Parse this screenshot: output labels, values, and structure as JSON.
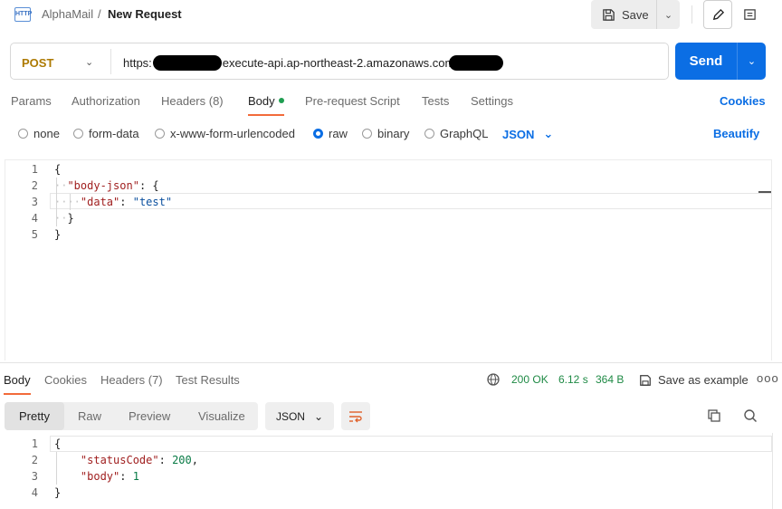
{
  "header": {
    "app_icon_text": "HTTP",
    "breadcrumb_parent": "AlphaMail",
    "breadcrumb_sep": "/",
    "title": "New Request",
    "save_label": "Save"
  },
  "request": {
    "method": "POST",
    "url_prefix": "https:",
    "url_middle": "execute-api.ap-northeast-2.amazonaws.com",
    "send_label": "Send"
  },
  "request_tabs": {
    "params": "Params",
    "authorization": "Authorization",
    "headers": "Headers (8)",
    "body": "Body",
    "pre_request": "Pre-request Script",
    "tests": "Tests",
    "settings": "Settings",
    "cookies": "Cookies"
  },
  "body_types": {
    "none": "none",
    "form_data": "form-data",
    "urlencoded": "x-www-form-urlencoded",
    "raw": "raw",
    "binary": "binary",
    "graphql": "GraphQL",
    "selected_format": "JSON",
    "beautify": "Beautify"
  },
  "request_body": {
    "line_numbers": [
      "1",
      "2",
      "3",
      "4",
      "5"
    ],
    "l1": "{",
    "l2_key": "\"body-json\"",
    "l2_rest": ": {",
    "l3_key": "\"data\"",
    "l3_sep": ": ",
    "l3_val": "\"test\"",
    "l4": "}",
    "l5": "}"
  },
  "response_tabs": {
    "body": "Body",
    "cookies": "Cookies",
    "headers": "Headers (7)",
    "test_results": "Test Results"
  },
  "response_status": {
    "status": "200 OK",
    "time": "6.12 s",
    "size": "364 B",
    "save_example": "Save as example",
    "more": "ooo"
  },
  "response_view": {
    "pretty": "Pretty",
    "raw": "Raw",
    "preview": "Preview",
    "visualize": "Visualize",
    "format": "JSON"
  },
  "response_body": {
    "line_numbers": [
      "1",
      "2",
      "3",
      "4"
    ],
    "l1": "{",
    "l2_key": "\"statusCode\"",
    "l2_sep": ": ",
    "l2_val": "200",
    "l2_end": ",",
    "l3_key": "\"body\"",
    "l3_sep": ": ",
    "l3_val": "1",
    "l4": "}"
  },
  "colors": {
    "accent": "#0b6ee4",
    "method": "#ad7a03",
    "tab_active": "#f26b3a",
    "status_ok": "#1f8a45"
  }
}
